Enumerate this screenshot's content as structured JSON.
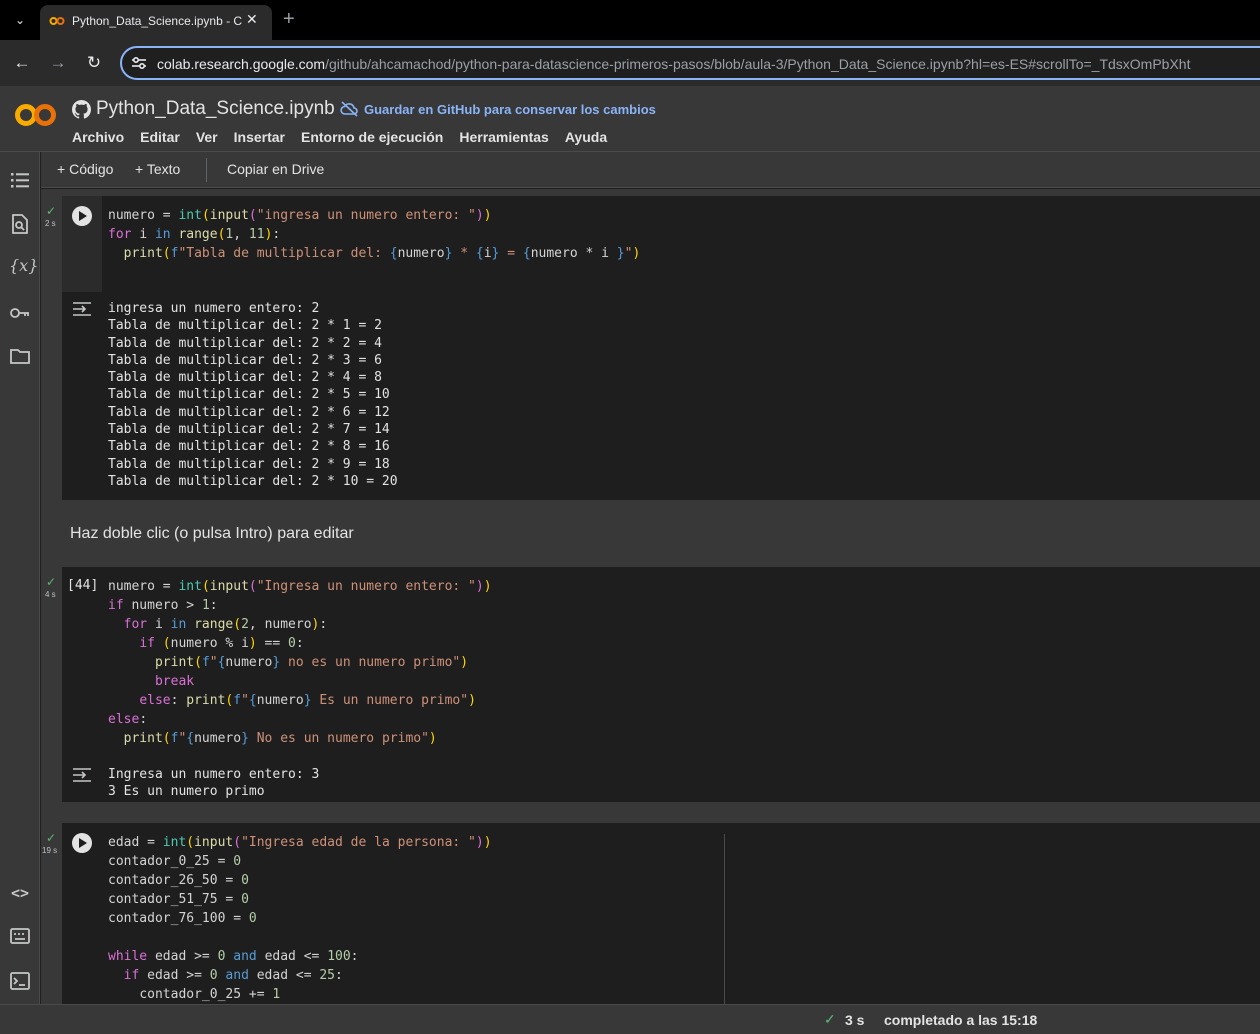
{
  "browser": {
    "tab_title": "Python_Data_Science.ipynb - Co",
    "url_host": "colab.research.google.com",
    "url_path": "/github/ahcamachod/python-para-datascience-primeros-pasos/blob/aula-3/Python_Data_Science.ipynb?hl=es-ES#scrollTo=_TdsxOmPbXht"
  },
  "colab": {
    "notebook_title": "Python_Data_Science.ipynb",
    "save_github": "Guardar en GitHub para conservar los cambios",
    "menu": [
      "Archivo",
      "Editar",
      "Ver",
      "Insertar",
      "Entorno de ejecución",
      "Herramientas",
      "Ayuda"
    ],
    "toolbar": {
      "add_code": "Código",
      "add_text": "Texto",
      "copy_drive": "Copiar en Drive"
    }
  },
  "cells": {
    "cell1": {
      "time": "2 s",
      "output": "ingresa un numero entero: 2\nTabla de multiplicar del: 2 * 1 = 2\nTabla de multiplicar del: 2 * 2 = 4\nTabla de multiplicar del: 2 * 3 = 6\nTabla de multiplicar del: 2 * 4 = 8\nTabla de multiplicar del: 2 * 5 = 10\nTabla de multiplicar del: 2 * 6 = 12\nTabla de multiplicar del: 2 * 7 = 14\nTabla de multiplicar del: 2 * 8 = 16\nTabla de multiplicar del: 2 * 9 = 18\nTabla de multiplicar del: 2 * 10 = 20"
    },
    "md": {
      "text": "Haz doble clic (o pulsa Intro) para editar"
    },
    "cell2": {
      "exec_count": "[44]",
      "time": "4 s",
      "output": "Ingresa un numero entero: 3\n3 Es un numero primo"
    },
    "cell3": {
      "time": "19 s"
    }
  },
  "status": {
    "time": "3 s",
    "completed": "completado a las 15:18"
  }
}
